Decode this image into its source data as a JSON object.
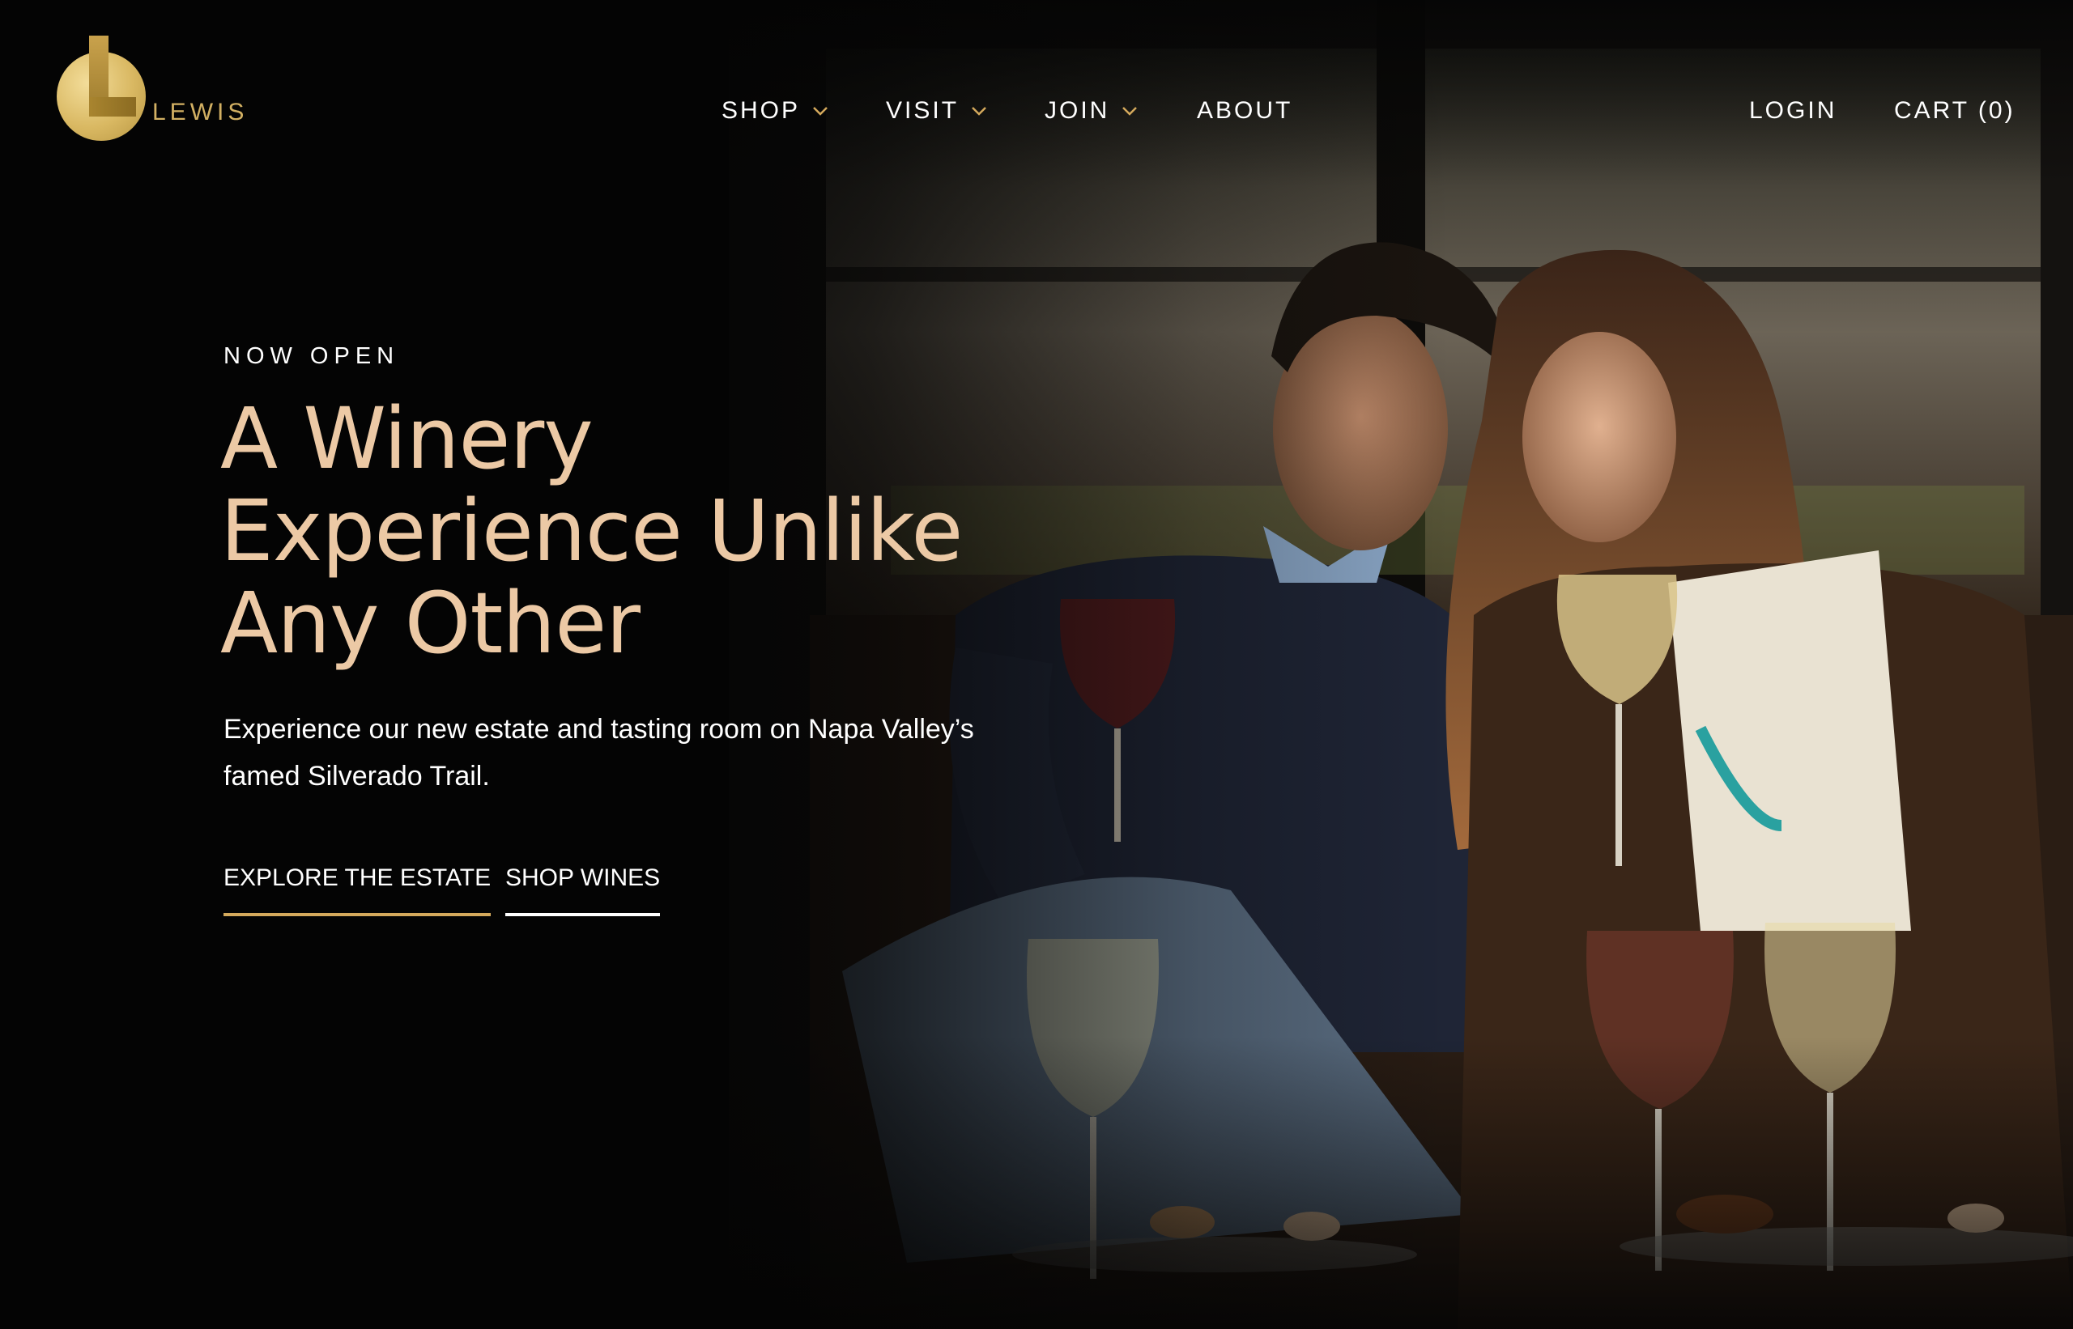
{
  "brand": {
    "logo_text": "LEWIS",
    "accent_color": "#d2b063"
  },
  "nav": {
    "items": [
      {
        "label": "SHOP",
        "has_dropdown": true
      },
      {
        "label": "VISIT",
        "has_dropdown": true
      },
      {
        "label": "JOIN",
        "has_dropdown": true
      },
      {
        "label": "ABOUT",
        "has_dropdown": false
      }
    ],
    "login_label": "LOGIN",
    "cart_label": "CART (0)"
  },
  "hero": {
    "eyebrow": "NOW OPEN",
    "headline_lines": [
      "A Winery",
      "Experience Unlike",
      "Any Other"
    ],
    "headline_color": "#ecc9a5",
    "subcopy_lines": [
      "Experience our new estate and tasting room on Napa Valley’s",
      "famed Silverado Trail."
    ],
    "cta_primary": "EXPLORE THE ESTATE",
    "cta_primary_underline_color": "#d4a95c",
    "cta_secondary": "SHOP WINES",
    "cta_secondary_underline_color": "#ffffff"
  }
}
